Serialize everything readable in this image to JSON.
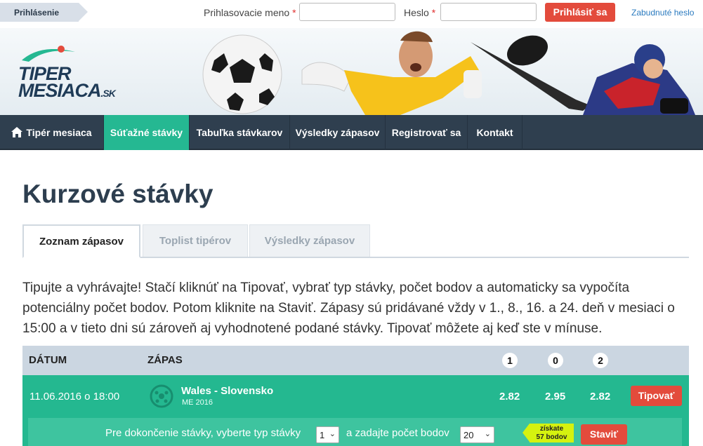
{
  "topbar": {
    "login_tag": "Prihlásenie",
    "username_label": "Prihlasovacie meno",
    "password_label": "Heslo",
    "required_mark": "*",
    "login_button": "Prihlásiť sa",
    "forgot_link": "Zabudnuté heslo"
  },
  "logo": {
    "line1": "TIPER",
    "line2": "MESIACA",
    "suffix": ".SK"
  },
  "nav": {
    "items": [
      {
        "label": "Tipér mesiaca",
        "icon": "home-icon"
      },
      {
        "label": "Súťažné stávky",
        "active": true
      },
      {
        "label": "Tabuľka stávkarov"
      },
      {
        "label": "Výsledky zápasov"
      },
      {
        "label": "Registrovať sa"
      },
      {
        "label": "Kontakt"
      }
    ]
  },
  "page": {
    "title": "Kurzové stávky"
  },
  "tabs": [
    "Zoznam zápasov",
    "Toplist tipérov",
    "Výsledky zápasov"
  ],
  "intro": "Tipujte a vyhrávajte! Stačí kliknúť na Tipovať, vybrať typ stávky, počet bodov a automaticky sa vypočíta potenciálny počet bodov. Potom kliknite na Staviť. Zápasy sú pridávané vždy v 1., 8., 16. a 24. deň v mesiaci o 15:00 a v tieto dni sú zároveň aj vyhodnotené podané stávky. Tipovať môžete aj keď ste v mínuse.",
  "table": {
    "headers": {
      "date": "DÁTUM",
      "match": "ZÁPAS",
      "h1": "1",
      "h0": "0",
      "h2": "2"
    },
    "rows": [
      {
        "date": "11.06.2016 o 18:00",
        "match": "Wales - Slovensko",
        "competition": "ME 2016",
        "odd1": "2.82",
        "odd0": "2.95",
        "odd2": "2.82",
        "tip_button": "Tipovať"
      }
    ],
    "bet": {
      "text1": "Pre dokončenie stávky, vyberte typ stávky",
      "bet_type": "1",
      "text2": "a zadajte počet bodov",
      "points": "20",
      "win_label": "získate",
      "win_value": "57 bodov",
      "bet_button": "Staviť"
    }
  },
  "colors": {
    "accent": "#25b892",
    "nav": "#2f3f4f",
    "button": "#e34b3c",
    "title": "#2d3e4f"
  }
}
